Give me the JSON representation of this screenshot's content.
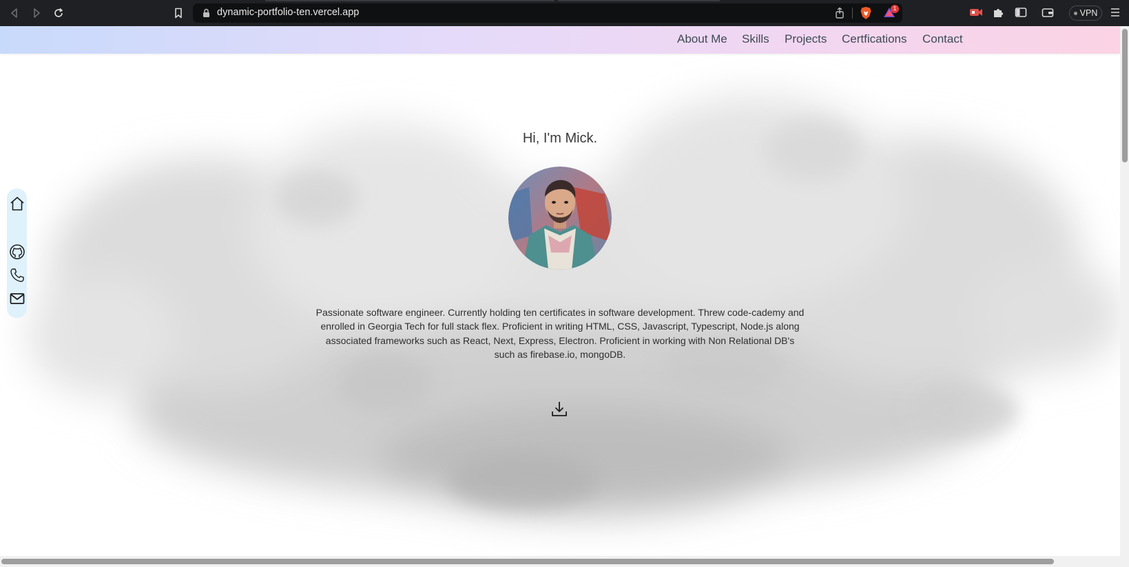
{
  "browser": {
    "url": "dynamic-portfolio-ten.vercel.app",
    "alert_count": "1",
    "vpn_label": "VPN",
    "icons": [
      "back-icon",
      "forward-icon",
      "reload-icon",
      "bookmark-icon",
      "lock-icon",
      "share-icon",
      "brave-shield-icon",
      "brave-rewards-icon",
      "media-icon",
      "extensions-icon",
      "sidebar-icon",
      "wallet-icon",
      "menu-icon"
    ]
  },
  "nav": {
    "items": [
      {
        "label": "About Me"
      },
      {
        "label": "Skills"
      },
      {
        "label": "Projects"
      },
      {
        "label": "Certfications"
      },
      {
        "label": "Contact"
      }
    ],
    "gradient": [
      "#c8dafb",
      "#e5dafa",
      "#f3d6f0",
      "#fbd3e4"
    ]
  },
  "sidebar": {
    "icons": [
      "home-icon",
      "github-icon",
      "phone-icon",
      "mail-icon"
    ],
    "background": "#dff1fb"
  },
  "hero": {
    "greeting": "Hi, I'm Mick.",
    "bio": "Passionate software engineer. Currently holding ten certificates in software development. Threw code-cademy and enrolled in Georgia Tech for full stack flex. Proficient in writing HTML, CSS, Javascript, Typescript, Node.js along associated frameworks such as React, Next, Express, Electron. Proficient in working with Non Relational DB's such as firebase.io, mongoDB.",
    "download_icon": "download-icon"
  }
}
